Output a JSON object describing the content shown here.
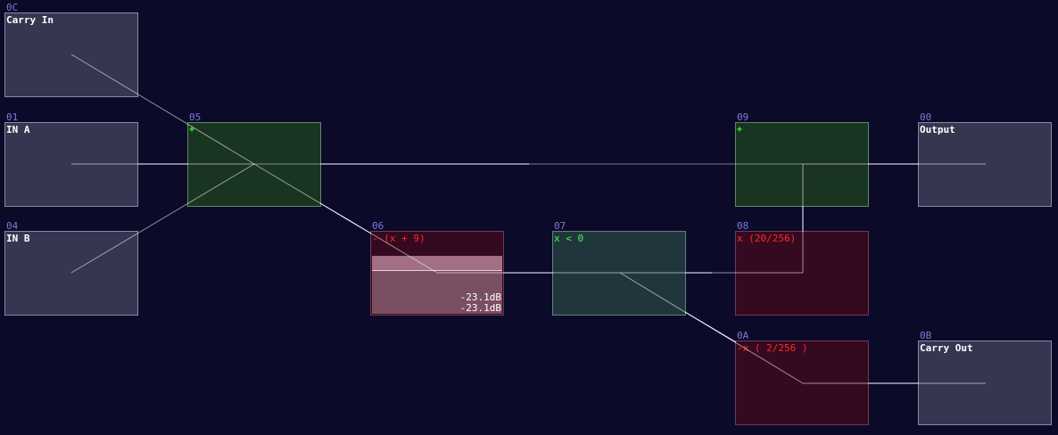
{
  "colors": {
    "background": "#0b0a29",
    "io_node": "#363650",
    "add_node": "#193521",
    "mul_node": "#350a20",
    "cmp_node": "#21363c",
    "node_id": "#7b7bd8",
    "op_label_green": "#3bff3b",
    "op_label_red": "#ff2a2a",
    "wire": "#ffffff"
  },
  "nodes": {
    "carry_in": {
      "id": "0C",
      "label": "Carry In"
    },
    "in_a": {
      "id": "01",
      "label": "IN A"
    },
    "in_b": {
      "id": "04",
      "label": "IN B"
    },
    "add_ab": {
      "id": "05",
      "label": "+"
    },
    "mul_neg": {
      "id": "06",
      "label": "- (x + 9)",
      "meter_top": "-23.1dB",
      "meter_bottom": "-23.1dB"
    },
    "cmp": {
      "id": "07",
      "label": "x < 0"
    },
    "add_out": {
      "id": "09",
      "label": "+"
    },
    "mul_scale": {
      "id": "08",
      "label": "x (20/256)"
    },
    "mul_carry": {
      "id": "0A",
      "label": "-x ( 2/256 )"
    },
    "output": {
      "id": "00",
      "label": "Output"
    },
    "carry_out": {
      "id": "0B",
      "label": "Carry Out"
    }
  }
}
